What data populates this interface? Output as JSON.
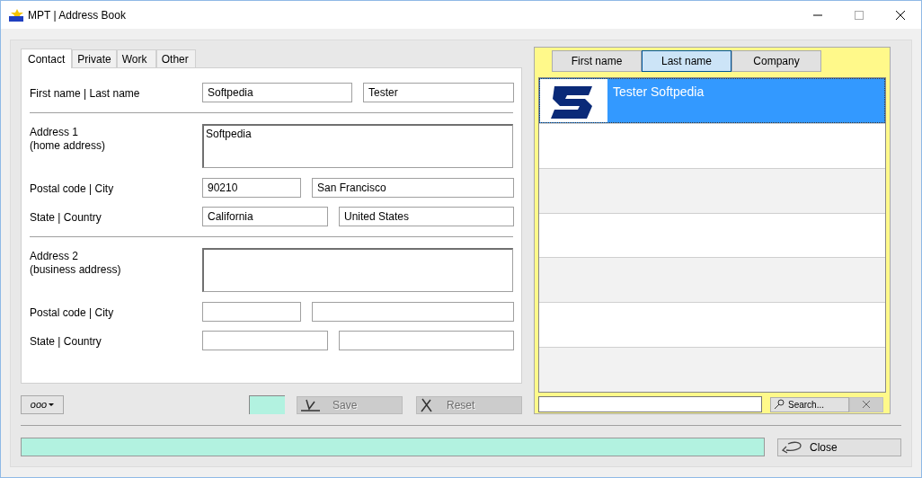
{
  "window": {
    "title": "MPT | Address Book"
  },
  "tabs": [
    {
      "label": "Contact",
      "selected": true
    },
    {
      "label": "Private",
      "selected": false
    },
    {
      "label": "Work",
      "selected": false
    },
    {
      "label": "Other",
      "selected": false
    }
  ],
  "form": [
    {
      "kind": "name",
      "label": [
        "First name | Last name"
      ],
      "fields": [
        {
          "value": "Softpedia"
        },
        {
          "value": "Tester"
        }
      ]
    },
    {
      "kind": "divider"
    },
    {
      "kind": "address",
      "label": [
        "Address 1",
        "(home address)"
      ],
      "fields": [
        {
          "value": "Softpedia"
        }
      ]
    },
    {
      "kind": "postal",
      "label": [
        "Postal code | City"
      ],
      "fields": [
        {
          "value": "90210"
        },
        {
          "value": "San Francisco"
        }
      ]
    },
    {
      "kind": "state",
      "label": [
        "State | Country"
      ],
      "fields": [
        {
          "value": "California"
        },
        {
          "value": "United States"
        }
      ]
    },
    {
      "kind": "divider"
    },
    {
      "kind": "address",
      "label": [
        "Address 2",
        "(business address)"
      ]
    },
    {
      "kind": "postal",
      "label": [
        "Postal code | City"
      ]
    },
    {
      "kind": "state",
      "label": [
        "State | Country"
      ]
    }
  ],
  "actions": {
    "menu": {
      "label": "ooo"
    },
    "save": {
      "label": "Save",
      "disabled": true
    },
    "reset": {
      "label": "Reset",
      "disabled": true
    }
  },
  "list": {
    "columns": [
      {
        "label": "First name",
        "selected": false
      },
      {
        "label": "Last name",
        "selected": true
      },
      {
        "label": "Company",
        "selected": false
      }
    ],
    "contacts": [
      {
        "name": "Tester Softpedia",
        "selected": true
      }
    ],
    "search_button": "Search..."
  },
  "close_button": "Close"
}
